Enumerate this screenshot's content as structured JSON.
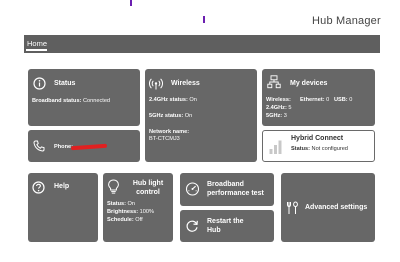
{
  "header": {
    "title": "Hub Manager"
  },
  "nav": {
    "home": "Home"
  },
  "status": {
    "title": "Status",
    "broadband_label": "Broadband status:",
    "broadband_value": "Connected"
  },
  "phone": {
    "label": "Phone:"
  },
  "wireless": {
    "title": "Wireless",
    "ghz24_label": "2.4GHz status:",
    "ghz24_value": "On",
    "ghz5_label": "5GHz status:",
    "ghz5_value": "On",
    "network_label": "Network name:",
    "network_value": "BT-CTCMJ3"
  },
  "devices": {
    "title": "My devices",
    "wireless_label": "Wireless:",
    "ethernet_label": "Ethernet:",
    "ethernet_value": "0",
    "usb_label": "USB:",
    "usb_value": "0",
    "ghz24_label": "2.4GHz:",
    "ghz24_value": "5",
    "ghz5_label": "5GHz:",
    "ghz5_value": "3"
  },
  "hybrid": {
    "title": "Hybrid Connect",
    "status_label": "Status:",
    "status_value": "Not configured"
  },
  "help": {
    "title": "Help"
  },
  "hublight": {
    "title_line1": "Hub light",
    "title_line2": "control",
    "status_label": "Status:",
    "status_value": "On",
    "brightness_label": "Brightness:",
    "brightness_value": "100%",
    "schedule_label": "Schedule:",
    "schedule_value": "Off"
  },
  "perf": {
    "title_line1": "Broadband",
    "title_line2": "performance test"
  },
  "restart": {
    "title_line1": "Restart the",
    "title_line2": "Hub"
  },
  "advanced": {
    "title": "Advanced settings"
  },
  "colors": {
    "tile": "#676767",
    "nav": "#5f5f5f",
    "accent": "#6b1fb0",
    "redaction": "#e02020"
  },
  "icons": [
    "info-icon",
    "phone-icon",
    "wifi-icon",
    "network-icon",
    "signal-bars-icon",
    "help-icon",
    "lightbulb-icon",
    "speedometer-icon",
    "restart-icon",
    "tools-icon"
  ]
}
